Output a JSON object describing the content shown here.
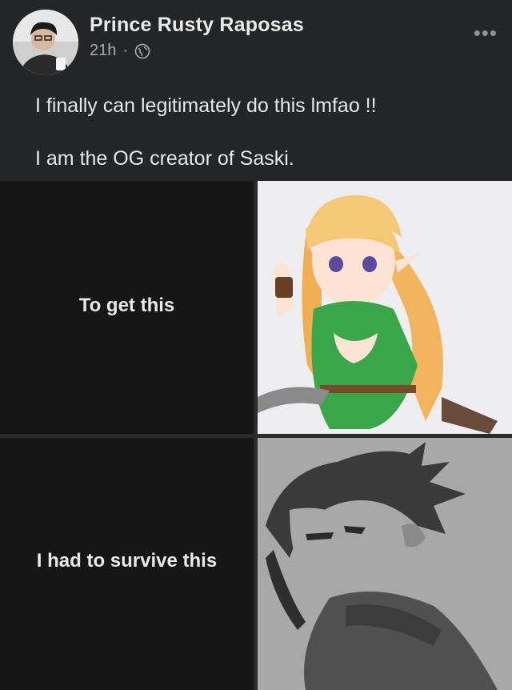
{
  "post": {
    "author": "Prince Rusty Raposas",
    "time": "21h",
    "separator": "·",
    "privacy_icon": "globe-icon",
    "more_icon": "more-options-icon",
    "text_line1": "I finally can legitimately do this lmfao !!",
    "text_line2": "I am the OG creator of Saski."
  },
  "meme": {
    "caption_top": "To get this",
    "caption_bottom": "I had to survive this",
    "image_top": "anime-elf-girl-drawing",
    "image_bottom": "pencil-sketch-drawing"
  }
}
